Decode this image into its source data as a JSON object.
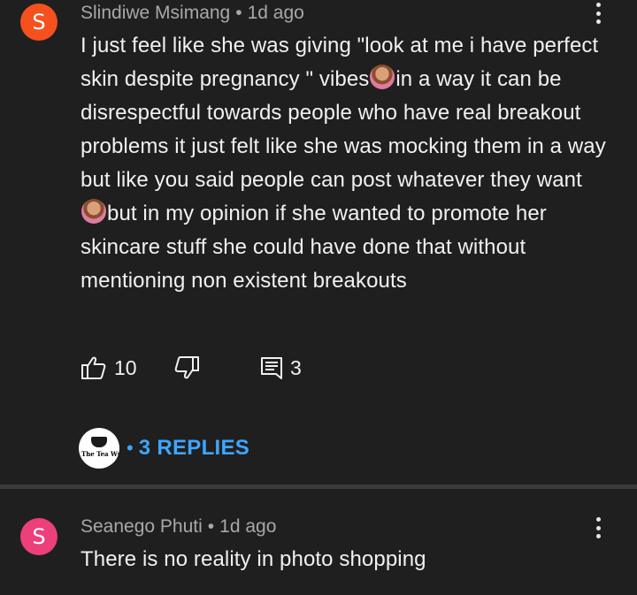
{
  "comments": [
    {
      "avatar_letter": "S",
      "avatar_color": "#f4511e",
      "author": "Slindiwe Msimang",
      "separator": "•",
      "time": "1d ago",
      "text_parts": [
        "I just feel like she was giving \"look at me i have perfect skin despite pregnancy \" vibes",
        "in a way it can be disrespectful towards people who have real breakout problems it just felt like she was mocking them in a way but like you said people can post whatever they want ",
        "but in my opinion if she wanted to promote her skincare stuff she could have done that without mentioning non existent breakouts"
      ],
      "emoji": "person-shrugging-emoji",
      "likes": "10",
      "replies_count": "3",
      "replies_label": "3 REPLIES",
      "replies_dot": "•",
      "creator_avatar_text": "The Tea Wrap"
    },
    {
      "avatar_letter": "S",
      "avatar_color": "#ec407a",
      "author": "Seanego Phuti",
      "separator": "•",
      "time": "1d ago",
      "text": "There is no reality in photo shopping"
    }
  ],
  "colors": {
    "background": "#1f1f1f",
    "text": "#f1f1f1",
    "meta": "#a8a8a8",
    "link": "#3ea6ff",
    "divider": "#3a3a3a"
  }
}
